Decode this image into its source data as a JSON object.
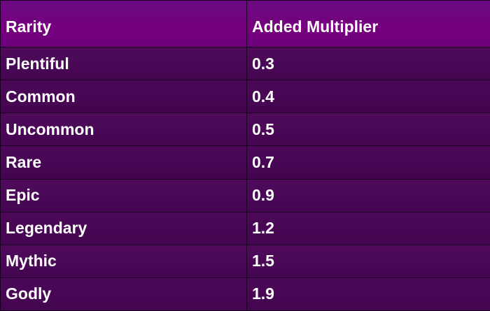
{
  "table": {
    "headers": [
      "Rarity",
      "Added Multiplier"
    ],
    "rows": [
      [
        "Plentiful",
        "0.3"
      ],
      [
        "Common",
        "0.4"
      ],
      [
        "Uncommon",
        "0.5"
      ],
      [
        "Rare",
        "0.7"
      ],
      [
        "Epic",
        "0.9"
      ],
      [
        "Legendary",
        "1.2"
      ],
      [
        "Mythic",
        "1.5"
      ],
      [
        "Godly",
        "1.9"
      ]
    ]
  },
  "colors": {
    "header_bg": "#76007f",
    "row_bg": "#4a0856",
    "border": "#1a0020",
    "text": "#ffffff"
  }
}
